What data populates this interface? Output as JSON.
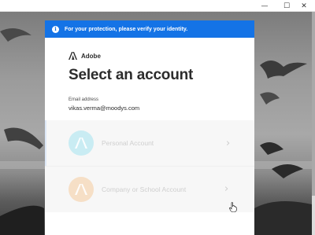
{
  "window": {
    "minimize_glyph": "—",
    "maximize_glyph": "☐",
    "close_glyph": "✕"
  },
  "banner": {
    "icon": "info-icon",
    "icon_glyph": "i",
    "text": "For your protection, please verify your identity.",
    "color": "#1473e6"
  },
  "brand": {
    "logo": "adobe-logo-icon",
    "name": "Adobe"
  },
  "heading": "Select an account",
  "email": {
    "label": "Email address",
    "value": "vikas.verma@moodys.com"
  },
  "accounts": [
    {
      "label": "Personal Account",
      "icon": "personal-account-icon",
      "avatar_color": "#c9ecf3"
    },
    {
      "label": "Company or School Account",
      "icon": "company-account-icon",
      "avatar_color": "#f6dfc6"
    }
  ],
  "chevron_glyph": "›",
  "colors": {
    "accent": "#1473e6",
    "text": "#2c2c2c"
  }
}
